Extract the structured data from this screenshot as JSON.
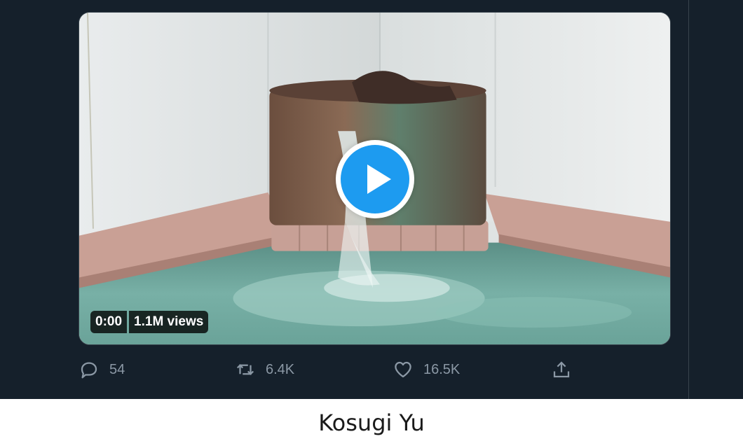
{
  "video": {
    "duration_label": "0:00",
    "views_label": "1.1M views",
    "play_icon": "play-icon"
  },
  "actions": {
    "reply": {
      "icon": "reply-icon",
      "count": "54"
    },
    "retweet": {
      "icon": "retweet-icon",
      "count": "6.4K"
    },
    "like": {
      "icon": "heart-icon",
      "count": "16.5K"
    },
    "share": {
      "icon": "share-icon"
    }
  },
  "caption": {
    "author": "Kosugi Yu"
  },
  "colors": {
    "background_dark": "#15202b",
    "accent_blue": "#1d9bf0",
    "muted_text": "#8b98a5",
    "caption_bg": "#ffffff"
  }
}
